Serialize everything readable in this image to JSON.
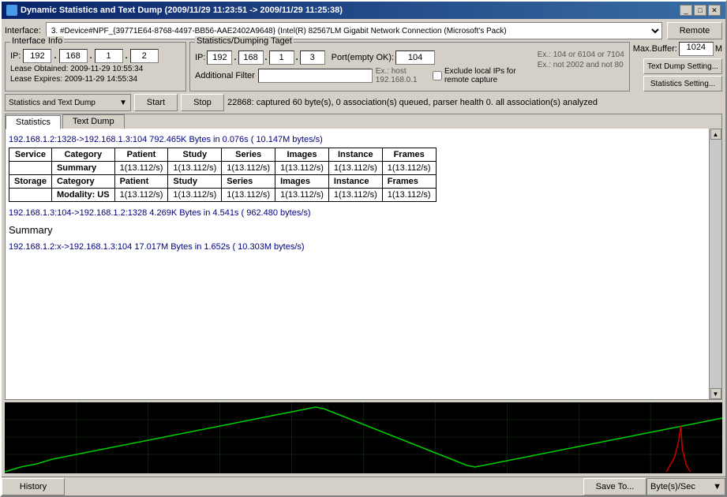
{
  "window": {
    "title": "Dynamic Statistics and Text Dump (2009/11/29 11:23:51 -> 2009/11/29 11:25:38)",
    "icon": "📊"
  },
  "toolbar": {
    "interface_label": "Interface:",
    "interface_value": "3. #Device#NPF_{39771E64-8768-4497-BB56-AAE2402A9648} (Intel(R) 82567LM Gigabit Network Connection (Microsoft's Pack)",
    "remote_label": "Remote"
  },
  "interface_info": {
    "title": "Interface Info",
    "ip_label": "IP:",
    "ip_parts": [
      "192",
      "168",
      "1",
      "2"
    ],
    "lease_obtained": "Lease Obtained: 2009-11-29 10:55:34",
    "lease_expires": "Lease Expires: 2009-11-29 14:55:34"
  },
  "stats_target": {
    "title": "Statistics/Dumping Taget",
    "ip_label": "IP:",
    "ip_parts": [
      "192",
      "168",
      "1",
      "3"
    ],
    "port_label": "Port(empty OK):",
    "port_value": "104",
    "example1": "Ex.: 104 or 6104 or 7104",
    "example2": "Ex.: not 2002 and not 80",
    "filter_label": "Additional Filter",
    "filter_example": "Ex.: host 192.168.0.1",
    "checkbox_label": "Exclude local IPs for remote capture",
    "max_buffer_label": "Max.Buffer:",
    "max_buffer_value": "1024",
    "max_buffer_unit": "M",
    "text_dump_btn": "Text Dump Setting...",
    "stats_setting_btn": "Statistics Setting..."
  },
  "controls": {
    "dropdown_label": "Statistics and Text Dump",
    "start_btn": "Start",
    "stop_btn": "Stop",
    "status_text": "22868: captured 60 byte(s), 0 association(s) queued, parser health 0.          all association(s) analyzed"
  },
  "tabs": {
    "statistics_label": "Statistics",
    "text_dump_label": "Text Dump"
  },
  "main_content": {
    "connection1": {
      "header": "192.168.1.2:1328->192.168.1.3:104     792.465K Bytes in 0.076s ( 10.147M bytes/s)",
      "table": {
        "headers": [
          "Service",
          "Category",
          "Patient",
          "Study",
          "Series",
          "Images",
          "Instance",
          "Frames"
        ],
        "rows": [
          {
            "service": "",
            "category": "Summary",
            "patient": "1(13.112/s)",
            "study": "1(13.112/s)",
            "series": "1(13.112/s)",
            "images": "1(13.112/s)",
            "instance": "1(13.112/s)",
            "frames": "1(13.112/s)"
          },
          {
            "service": "Storage",
            "category": "Category",
            "patient": "Patient",
            "study": "Study",
            "series": "Series",
            "images": "Images",
            "instance": "Instance",
            "frames": "Frames"
          },
          {
            "service": "",
            "category": "Modality: US",
            "patient": "1(13.112/s)",
            "study": "1(13.112/s)",
            "series": "1(13.112/s)",
            "images": "1(13.112/s)",
            "instance": "1(13.112/s)",
            "frames": "1(13.112/s)"
          }
        ]
      }
    },
    "connection2": {
      "header": "192.168.1.3:104->192.168.1.2:1328     4.269K Bytes in 4.541s ( 962.480 bytes/s)"
    },
    "summary": {
      "label": "Summary"
    },
    "connection3": {
      "header": "192.168.1.2:x->192.168.1.3:104     17.017M Bytes in 1.652s ( 10.303M bytes/s)"
    }
  },
  "status_bar": {
    "history_label": "History",
    "save_label": "Save To...",
    "unit_label": "Byte(s)/Sec"
  }
}
